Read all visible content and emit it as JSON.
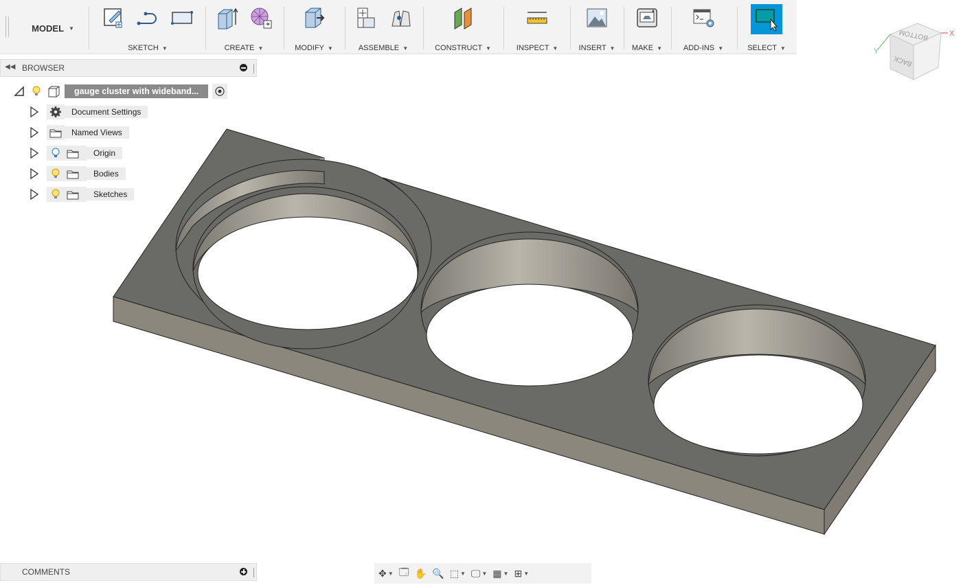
{
  "toolbar": {
    "workspace": "MODEL",
    "groups": [
      {
        "label": "SKETCH"
      },
      {
        "label": "CREATE"
      },
      {
        "label": "MODIFY"
      },
      {
        "label": "ASSEMBLE"
      },
      {
        "label": "CONSTRUCT"
      },
      {
        "label": "INSPECT"
      },
      {
        "label": "INSERT"
      },
      {
        "label": "MAKE"
      },
      {
        "label": "ADD-INS"
      },
      {
        "label": "SELECT"
      }
    ],
    "dropdown_caret": "▼"
  },
  "browser": {
    "title": "BROWSER",
    "root": {
      "label": "gauge cluster with wideband..."
    },
    "items": [
      {
        "label": "Document Settings",
        "icon": "gear-icon"
      },
      {
        "label": "Named Views",
        "icon": "folder-icon"
      },
      {
        "label": "Origin",
        "icon": "folder-icon"
      },
      {
        "label": "Bodies",
        "icon": "folder-icon"
      },
      {
        "label": "Sketches",
        "icon": "folder-icon"
      }
    ]
  },
  "comments": {
    "title": "COMMENTS"
  },
  "viewcube": {
    "top": "BOTTOM",
    "front": "BACK",
    "axis_x": "X",
    "axis_y": "Y"
  },
  "colors": {
    "accent": "#0696d7",
    "body": "#6a6a66",
    "toolbar_bg": "#f3f3f3"
  }
}
